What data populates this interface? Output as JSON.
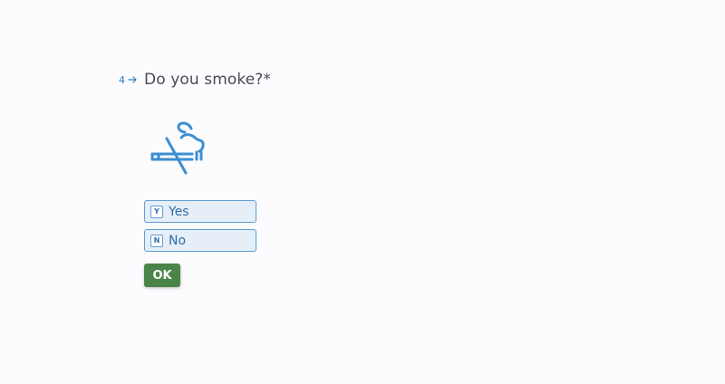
{
  "question": {
    "number": "4",
    "text": "Do you smoke?*"
  },
  "illustration": {
    "icon": "no-smoking-icon",
    "color": "#3d8fd1"
  },
  "choices": [
    {
      "key": "Y",
      "label": "Yes"
    },
    {
      "key": "N",
      "label": "No"
    }
  ],
  "ok_button": {
    "label": "OK",
    "color": "#4a8449"
  },
  "colors": {
    "accent": "#2f7fbf",
    "choice_bg": "#e6eef8",
    "choice_border": "#5d9fd6",
    "background": "#fcfbfe"
  }
}
